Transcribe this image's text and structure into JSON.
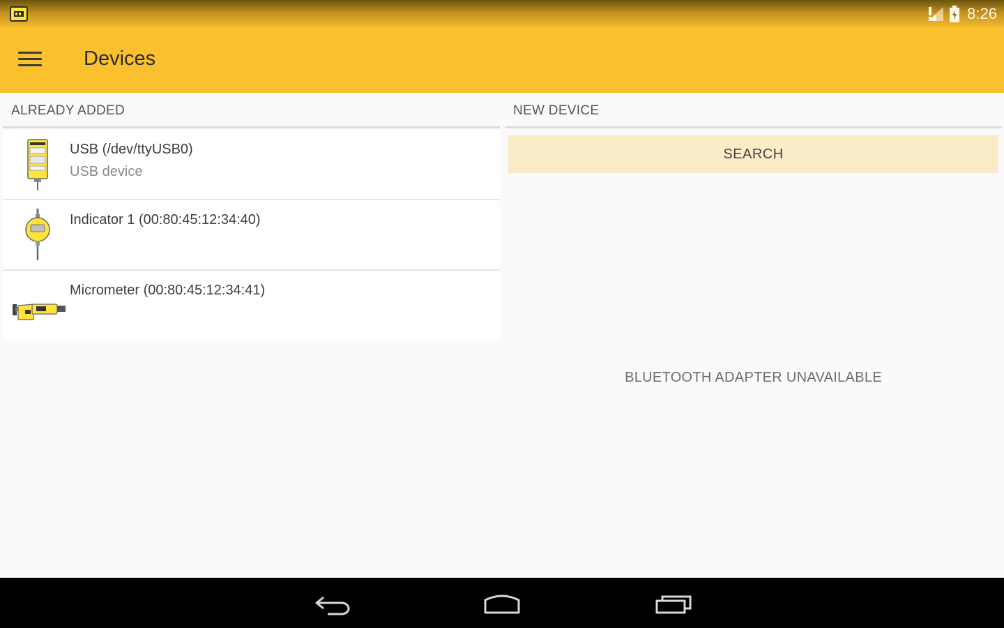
{
  "statusbar": {
    "time": "8:26",
    "icons": [
      "app-icon",
      "signal-icon",
      "battery-icon"
    ]
  },
  "appbar": {
    "title": "Devices",
    "menu_icon": "hamburger-menu-icon"
  },
  "already_added": {
    "header": "ALREADY ADDED",
    "devices": [
      {
        "name": "USB (/dev/ttyUSB0)",
        "subtitle": "USB device",
        "icon": "usb-device-icon"
      },
      {
        "name": "Indicator 1 (00:80:45:12:34:40)",
        "subtitle": "",
        "icon": "dial-indicator-icon"
      },
      {
        "name": "Micrometer (00:80:45:12:34:41)",
        "subtitle": "",
        "icon": "micrometer-icon"
      }
    ]
  },
  "new_device": {
    "header": "NEW DEVICE",
    "search_label": "SEARCH",
    "status": "BLUETOOTH ADAPTER UNAVAILABLE"
  },
  "navbar": {
    "icons": [
      "back-icon",
      "home-icon",
      "recents-icon"
    ]
  },
  "colors": {
    "primary": "#fbc02d",
    "search_button": "#fbecc8",
    "background": "#fafafa"
  }
}
